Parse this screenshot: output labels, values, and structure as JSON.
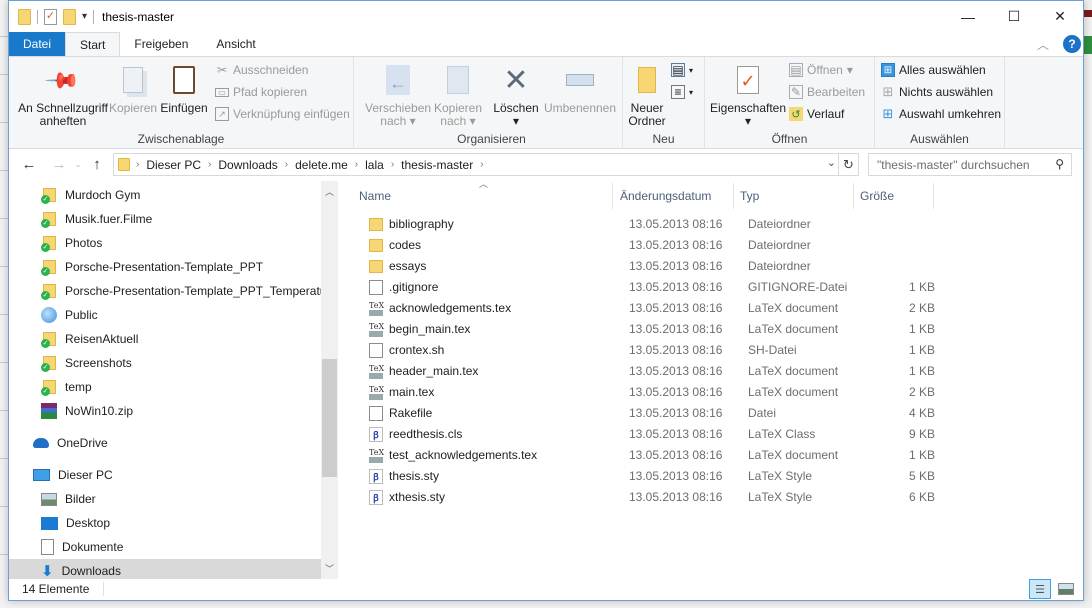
{
  "window": {
    "title": "thesis-master",
    "controls": {
      "minimize": "—",
      "maximize": "☐",
      "close": "✕"
    }
  },
  "ribbon_tabs": [
    {
      "label": "Datei"
    },
    {
      "label": "Start"
    },
    {
      "label": "Freigeben"
    },
    {
      "label": "Ansicht"
    }
  ],
  "ribbon": {
    "clipboard": {
      "label": "Zwischenablage",
      "pin": "An Schnellzugriff anheften",
      "copy": "Kopieren",
      "paste": "Einfügen",
      "cut": "Ausschneiden",
      "copy_path": "Pfad kopieren",
      "paste_shortcut": "Verknüpfung einfügen"
    },
    "organize": {
      "label": "Organisieren",
      "move_to": "Verschieben nach",
      "copy_to": "Kopieren nach",
      "delete": "Löschen",
      "rename": "Umbenennen"
    },
    "new": {
      "label": "Neu",
      "new_folder": "Neuer Ordner"
    },
    "open": {
      "label": "Öffnen",
      "properties": "Eigenschaften",
      "open": "Öffnen",
      "edit": "Bearbeiten",
      "history": "Verlauf"
    },
    "select": {
      "label": "Auswählen",
      "select_all": "Alles auswählen",
      "select_none": "Nichts auswählen",
      "invert": "Auswahl umkehren"
    }
  },
  "address": {
    "breadcrumbs": [
      "Dieser PC",
      "Downloads",
      "delete.me",
      "lala",
      "thesis-master"
    ],
    "search_placeholder": "\"thesis-master\" durchsuchen"
  },
  "nav_pane": {
    "items": [
      {
        "label": "Murdoch Gym",
        "icon": "sync-folder"
      },
      {
        "label": "Musik.fuer.Filme",
        "icon": "sync-folder"
      },
      {
        "label": "Photos",
        "icon": "sync-folder"
      },
      {
        "label": "Porsche-Presentation-Template_PPT",
        "icon": "sync-folder"
      },
      {
        "label": "Porsche-Presentation-Template_PPT_Temperatur",
        "icon": "sync-folder"
      },
      {
        "label": "Public",
        "icon": "globe"
      },
      {
        "label": "ReisenAktuell",
        "icon": "sync-folder"
      },
      {
        "label": "Screenshots",
        "icon": "sync-folder"
      },
      {
        "label": "temp",
        "icon": "sync-folder"
      },
      {
        "label": "NoWin10.zip",
        "icon": "zip"
      },
      {
        "label": "OneDrive",
        "icon": "cloud"
      },
      {
        "label": "Dieser PC",
        "icon": "pc"
      },
      {
        "label": "Bilder",
        "icon": "pictures"
      },
      {
        "label": "Desktop",
        "icon": "desktop"
      },
      {
        "label": "Dokumente",
        "icon": "documents"
      },
      {
        "label": "Downloads",
        "icon": "downloads",
        "selected": true
      }
    ]
  },
  "file_list": {
    "columns": {
      "name": "Name",
      "date": "Änderungsdatum",
      "type": "Typ",
      "size": "Größe"
    },
    "rows": [
      {
        "name": "bibliography",
        "date": "13.05.2013 08:16",
        "type": "Dateiordner",
        "size": "",
        "icon": "folder"
      },
      {
        "name": "codes",
        "date": "13.05.2013 08:16",
        "type": "Dateiordner",
        "size": "",
        "icon": "folder"
      },
      {
        "name": "essays",
        "date": "13.05.2013 08:16",
        "type": "Dateiordner",
        "size": "",
        "icon": "folder"
      },
      {
        "name": ".gitignore",
        "date": "13.05.2013 08:16",
        "type": "GITIGNORE-Datei",
        "size": "1 KB",
        "icon": "file"
      },
      {
        "name": "acknowledgements.tex",
        "date": "13.05.2013 08:16",
        "type": "LaTeX document",
        "size": "2 KB",
        "icon": "tex"
      },
      {
        "name": "begin_main.tex",
        "date": "13.05.2013 08:16",
        "type": "LaTeX document",
        "size": "1 KB",
        "icon": "tex"
      },
      {
        "name": "crontex.sh",
        "date": "13.05.2013 08:16",
        "type": "SH-Datei",
        "size": "1 KB",
        "icon": "file"
      },
      {
        "name": "header_main.tex",
        "date": "13.05.2013 08:16",
        "type": "LaTeX document",
        "size": "1 KB",
        "icon": "tex"
      },
      {
        "name": "main.tex",
        "date": "13.05.2013 08:16",
        "type": "LaTeX document",
        "size": "2 KB",
        "icon": "tex"
      },
      {
        "name": "Rakefile",
        "date": "13.05.2013 08:16",
        "type": "Datei",
        "size": "4 KB",
        "icon": "file"
      },
      {
        "name": "reedthesis.cls",
        "date": "13.05.2013 08:16",
        "type": "LaTeX Class",
        "size": "9 KB",
        "icon": "sty"
      },
      {
        "name": "test_acknowledgements.tex",
        "date": "13.05.2013 08:16",
        "type": "LaTeX document",
        "size": "1 KB",
        "icon": "tex"
      },
      {
        "name": "thesis.sty",
        "date": "13.05.2013 08:16",
        "type": "LaTeX Style",
        "size": "5 KB",
        "icon": "sty"
      },
      {
        "name": "xthesis.sty",
        "date": "13.05.2013 08:16",
        "type": "LaTeX Style",
        "size": "6 KB",
        "icon": "sty"
      }
    ]
  },
  "status": {
    "item_count": "14 Elemente"
  }
}
